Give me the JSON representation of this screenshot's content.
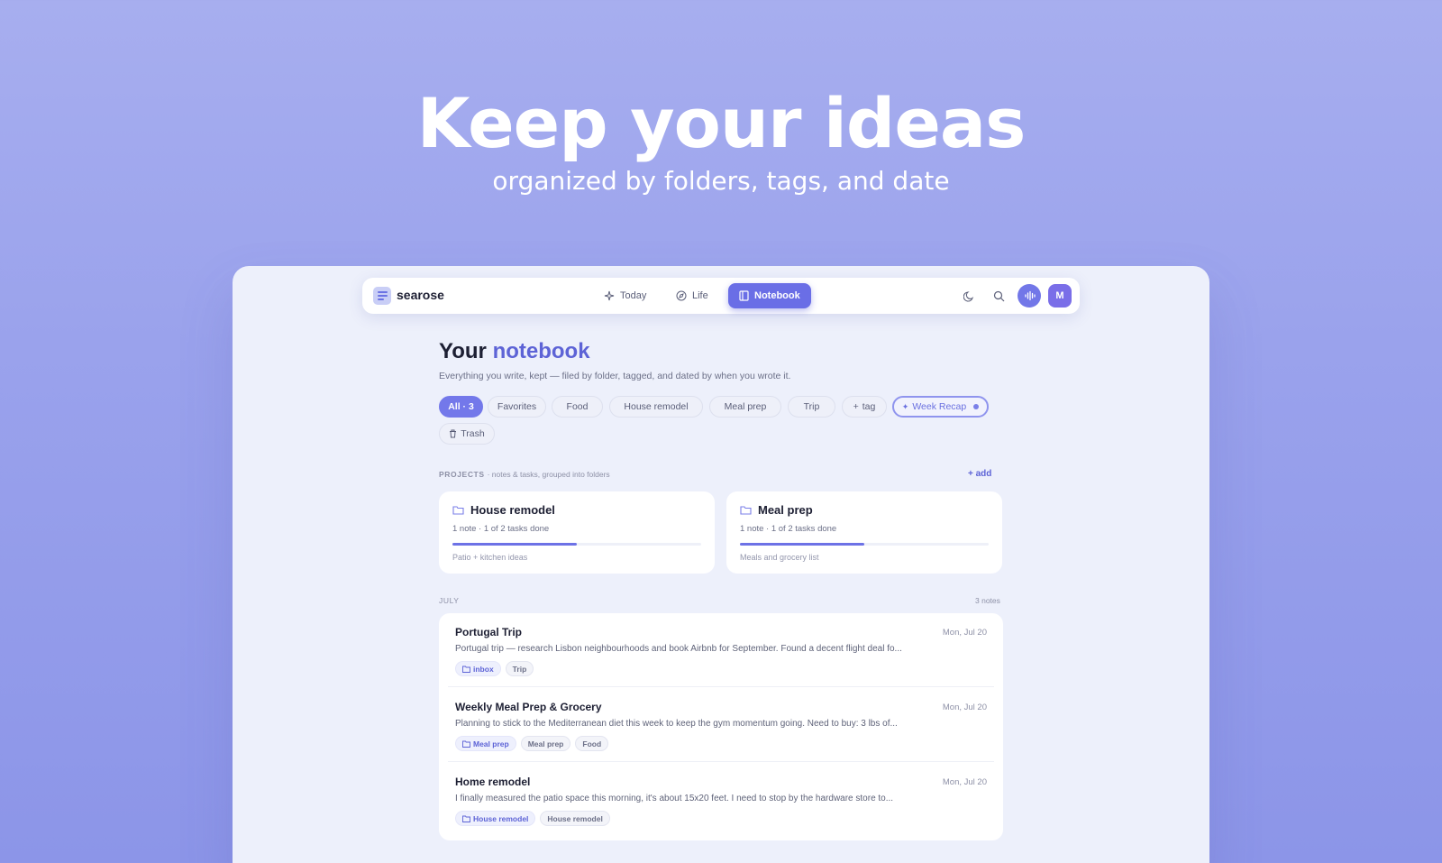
{
  "hero": {
    "title": "Keep your ideas",
    "subtitle": "organized by folders, tags, and date"
  },
  "navbar": {
    "brand": "searose",
    "tabs": [
      {
        "label": "Today",
        "icon": "sparkle-icon",
        "active": false
      },
      {
        "label": "Life",
        "icon": "compass-icon",
        "active": false
      },
      {
        "label": "Notebook",
        "icon": "notebook-icon",
        "active": true
      }
    ],
    "icons": [
      "moon-icon",
      "search-icon",
      "voice-wave-icon"
    ],
    "avatar_initial": "M"
  },
  "page": {
    "title_prefix": "Your",
    "title_accent": "notebook",
    "description": "Everything you write, kept — filed by folder, tagged, and dated by when you wrote it."
  },
  "filters": {
    "chips": [
      "All · 3",
      "Favorites",
      "Food",
      "House remodel",
      "Meal prep",
      "Trip",
      "tag",
      "Week Recap",
      "Trash"
    ],
    "active_index": 0
  },
  "projects": {
    "label": "PROJECTS",
    "sublabel": "· notes & tasks, grouped into folders",
    "add_label": "add",
    "items": [
      {
        "title": "House remodel",
        "meta": "1 note · 1 of 2 tasks done",
        "progress": 0.5,
        "description": "Patio + kitchen ideas"
      },
      {
        "title": "Meal prep",
        "meta": "1 note · 1 of 2 tasks done",
        "progress": 0.5,
        "description": "Meals and grocery list"
      }
    ]
  },
  "notes": {
    "month_label": "JULY",
    "count_label": "3 notes",
    "items": [
      {
        "title": "Portugal Trip",
        "date": "Mon, Jul 20",
        "excerpt": "Portugal trip — research Lisbon neighbourhoods and book Airbnb for September. Found a decent flight deal fo...",
        "folder": "inbox",
        "tags": [
          "Trip"
        ]
      },
      {
        "title": "Weekly Meal Prep & Grocery",
        "date": "Mon, Jul 20",
        "excerpt": "Planning to stick to the Mediterranean diet this week to keep the gym momentum going. Need to buy: 3 lbs of...",
        "folder": "Meal prep",
        "tags": [
          "Meal prep",
          "Food"
        ]
      },
      {
        "title": "Home remodel",
        "date": "Mon, Jul 20",
        "excerpt": "I finally measured the patio space this morning, it's about 15x20 feet. I need to stop by the hardware store to...",
        "folder": "House remodel",
        "tags": [
          "House remodel"
        ]
      }
    ]
  },
  "colors": {
    "accent": "#6a6ee6",
    "background_top": "#a7aeef",
    "background_bottom": "#8c95e8",
    "card": "#ffffff",
    "panel": "#edf0fb"
  }
}
